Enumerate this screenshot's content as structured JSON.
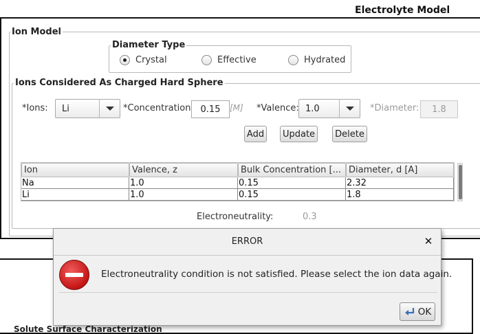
{
  "window": {
    "title": "Electrolyte Model"
  },
  "ion_model": {
    "title": "Ion Model",
    "diameter_type": {
      "title": "Diameter Type",
      "options": [
        {
          "label": "Crystal",
          "selected": true
        },
        {
          "label": "Effective",
          "selected": false
        },
        {
          "label": "Hydrated",
          "selected": false
        }
      ]
    },
    "hard_sphere": {
      "title": "Ions Considered As Charged Hard Sphere",
      "ions_label": "*Ions:",
      "ions_value": "Li",
      "concentration_label": "*Concentration:",
      "concentration_value": "0.15",
      "concentration_unit": "[M]",
      "valence_label": "*Valence:",
      "valence_value": "1.0",
      "diameter_label": "*Diameter:",
      "diameter_value": "1.8",
      "buttons": {
        "add": "Add",
        "update": "Update",
        "delete": "Delete"
      },
      "table": {
        "columns": [
          "Ion",
          "Valence, z",
          "Bulk Concentration [...",
          "Diameter, d [A]"
        ],
        "rows": [
          [
            "Na",
            "1.0",
            "0.15",
            "2.32"
          ],
          [
            "Li",
            "1.0",
            "0.15",
            "1.8"
          ]
        ]
      },
      "electroneutrality_label": "Electroneutrality:",
      "electroneutrality_value": "0.3"
    }
  },
  "dialog": {
    "title": "ERROR",
    "close_icon": "close-icon",
    "icon": "error-icon",
    "message": "Electroneutrality condition is not satisfied. Please select the ion data again.",
    "ok_label": "OK"
  },
  "lower_panel": {
    "text": "Solute Surface Characterization"
  },
  "colors": {
    "error_icon": "#c41515",
    "panel_border": "#111111"
  }
}
